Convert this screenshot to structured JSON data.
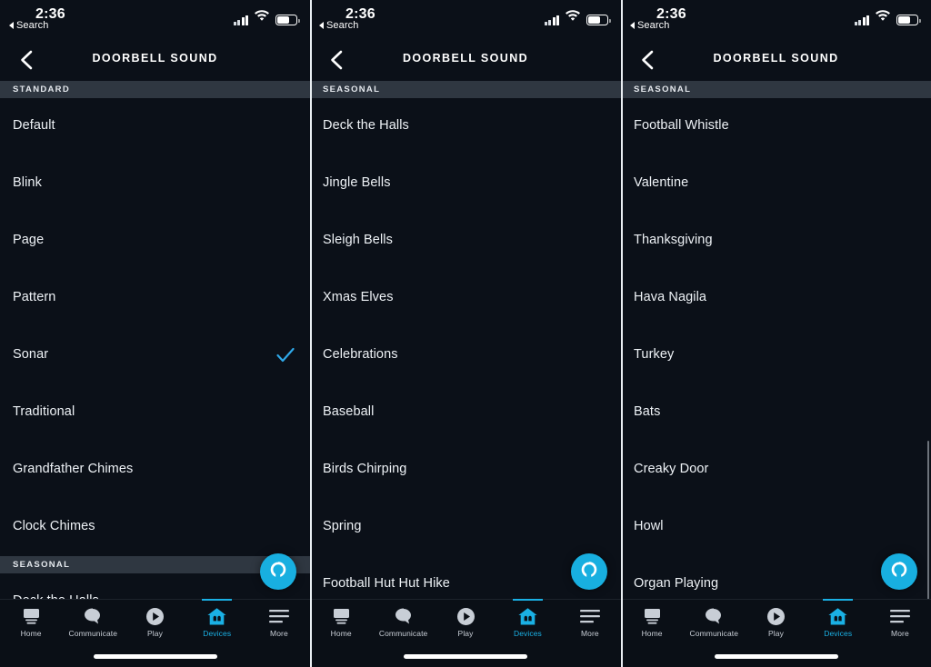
{
  "colors": {
    "background": "#0b1018",
    "section_header_bg": "#2f3741",
    "accent": "#1ab0e4",
    "alexa_blue": "#18afe0",
    "text": "#eef2f6",
    "rule": "#2b333d"
  },
  "status_bar": {
    "back_label": "Search",
    "time": "2:36",
    "signal_icon": "cellular-signal-icon",
    "wifi_icon": "wifi-icon",
    "battery_icon": "battery-icon"
  },
  "header": {
    "title": "DOORBELL SOUND",
    "back_icon": "chevron-left-icon"
  },
  "fab": {
    "icon": "alexa-icon",
    "name": "Alexa"
  },
  "tabbar": {
    "items": [
      {
        "label": "Home",
        "icon": "home-echo-show-icon",
        "active": false
      },
      {
        "label": "Communicate",
        "icon": "speech-bubble-icon",
        "active": false
      },
      {
        "label": "Play",
        "icon": "play-circle-icon",
        "active": false
      },
      {
        "label": "Devices",
        "icon": "house-devices-icon",
        "active": true
      },
      {
        "label": "More",
        "icon": "hamburger-menu-icon",
        "active": false
      }
    ]
  },
  "panels": [
    {
      "id": "panel-1",
      "section_label": "STANDARD",
      "rows": [
        {
          "label": "Default",
          "checked": false
        },
        {
          "label": "Blink",
          "checked": false
        },
        {
          "label": "Page",
          "checked": false
        },
        {
          "label": "Pattern",
          "checked": false
        },
        {
          "label": "Sonar",
          "checked": true
        },
        {
          "label": "Traditional",
          "checked": false
        },
        {
          "label": "Grandfather Chimes",
          "checked": false
        },
        {
          "label": "Clock Chimes",
          "checked": false
        }
      ],
      "second_section_label": "SEASONAL",
      "clipped_row": {
        "label": "Deck the Halls",
        "checked": false
      },
      "scrollbar": false
    },
    {
      "id": "panel-2",
      "section_label": "SEASONAL",
      "rows": [
        {
          "label": "Deck the Halls",
          "checked": false
        },
        {
          "label": "Jingle Bells",
          "checked": false
        },
        {
          "label": "Sleigh Bells",
          "checked": false
        },
        {
          "label": "Xmas Elves",
          "checked": false
        },
        {
          "label": "Celebrations",
          "checked": false
        },
        {
          "label": "Baseball",
          "checked": false
        },
        {
          "label": "Birds Chirping",
          "checked": false
        },
        {
          "label": "Spring",
          "checked": false
        },
        {
          "label": "Football Hut Hut Hike",
          "checked": false
        }
      ],
      "scrollbar": false
    },
    {
      "id": "panel-3",
      "section_label": "SEASONAL",
      "rows": [
        {
          "label": "Football Whistle",
          "checked": false
        },
        {
          "label": "Valentine",
          "checked": false
        },
        {
          "label": "Thanksgiving",
          "checked": false
        },
        {
          "label": "Hava Nagila",
          "checked": false
        },
        {
          "label": "Turkey",
          "checked": false
        },
        {
          "label": "Bats",
          "checked": false
        },
        {
          "label": "Creaky Door",
          "checked": false
        },
        {
          "label": "Howl",
          "checked": false
        },
        {
          "label": "Organ Playing",
          "checked": false
        }
      ],
      "scrollbar": true
    }
  ]
}
